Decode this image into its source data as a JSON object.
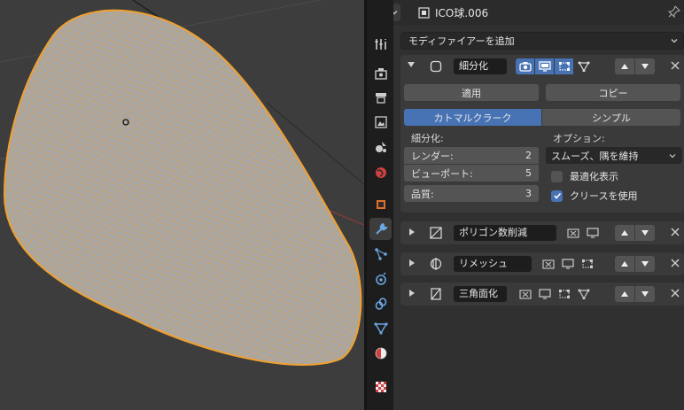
{
  "header": {
    "object_name": "ICO球.006"
  },
  "add_modifier_label": "モディファイアーを追加",
  "subdivision": {
    "name": "細分化",
    "apply_label": "適用",
    "copy_label": "コピー",
    "mode_catmull": "カトマルクラーク",
    "mode_simple": "シンプル",
    "subdiv_heading": "細分化:",
    "render_label": "レンダー:",
    "render_value": "2",
    "viewport_label": "ビューポート:",
    "viewport_value": "5",
    "quality_label": "品質:",
    "quality_value": "3",
    "options_heading": "オプション:",
    "uv_smooth": "スムーズ、隅を維持",
    "optimal_display": "最適化表示",
    "use_creases": "クリースを使用"
  },
  "modifiers_collapsed": [
    {
      "name": "ポリゴン数削減"
    },
    {
      "name": "リメッシュ"
    },
    {
      "name": "三角面化"
    }
  ],
  "colors": {
    "accent": "#4772b3",
    "wire": "#f0a030",
    "mesh": "#a8a8a8"
  }
}
